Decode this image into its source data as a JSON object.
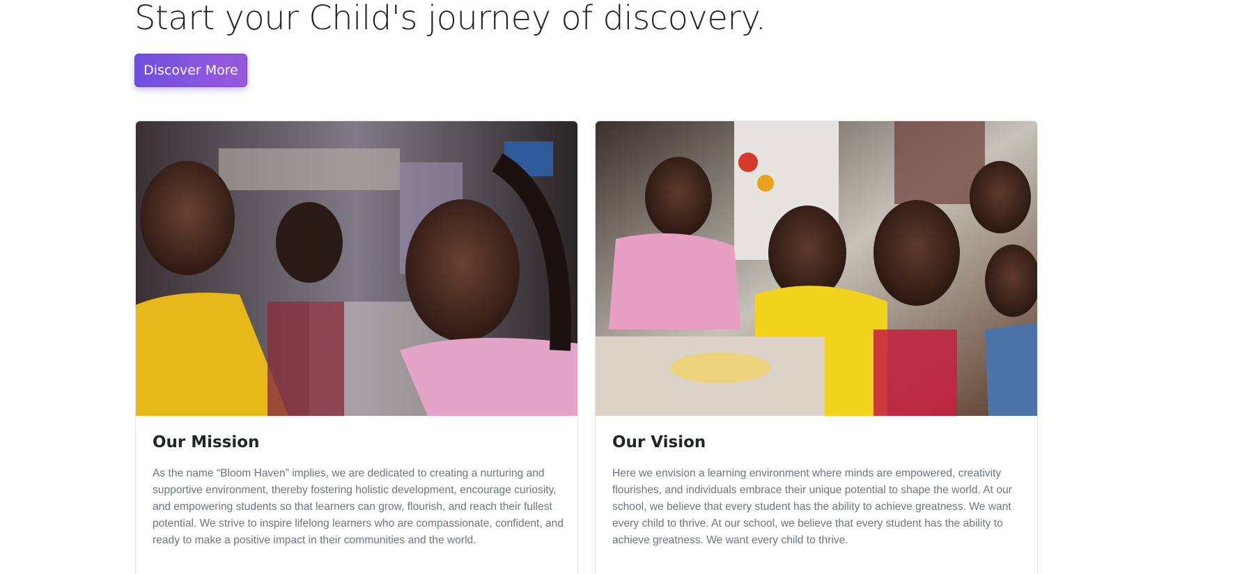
{
  "hero": {
    "title": "Start your Child's journey of discovery.",
    "cta_label": "Discover More"
  },
  "cards": [
    {
      "image_alt": "children-smiling-photo",
      "title": "Our Mission",
      "text": "As the name “Bloom Haven” implies, we are dedicated to creating a nurturing and supportive environment, thereby fostering holistic development, encourage curiosity, and empowering students so that learners can grow, flourish, and reach their fullest potential. We strive to inspire lifelong learners who are compassionate, confident, and ready to make a positive impact in their communities and the world."
    },
    {
      "image_alt": "children-cooking-photo",
      "title": "Our Vision",
      "text": "Here we envision a learning environment where minds are empowered, creativity flourishes, and individuals embrace their unique potential to shape the world. At our school, we believe that every student has the ability to achieve greatness. We want every child to thrive. At our school, we believe that every student has the ability to achieve greatness. We want every child to thrive."
    }
  ],
  "colors": {
    "button_start": "#6f4fe0",
    "button_end": "#9a59da",
    "heading": "#212529",
    "body_text": "#6c757d"
  }
}
